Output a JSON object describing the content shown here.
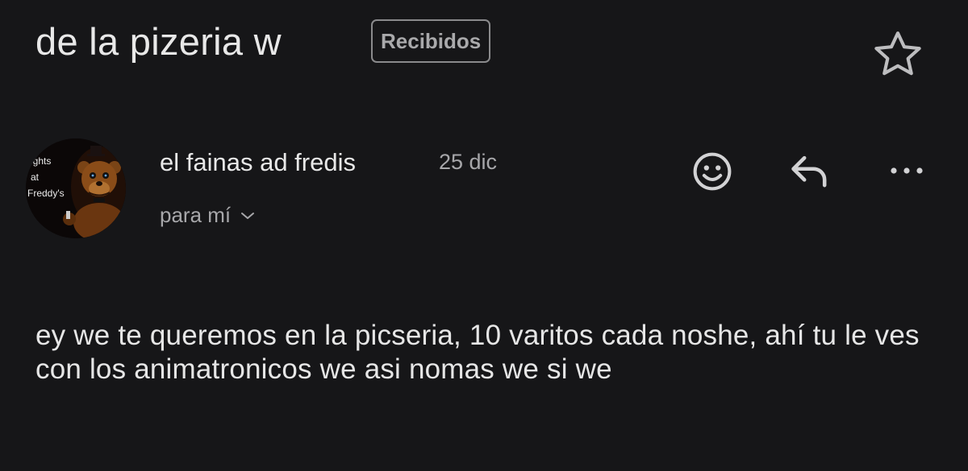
{
  "header": {
    "subject": "de la pizeria w",
    "label": "Recibidos",
    "star_icon": "star-outline-icon"
  },
  "message": {
    "avatar_text": [
      "ights",
      "at",
      "Freddy's"
    ],
    "sender": "el fainas ad fredis",
    "date": "25 dic",
    "recipient": "para mí",
    "actions": {
      "emoji_icon": "emoji-reaction-icon",
      "reply_icon": "reply-icon",
      "more_icon": "more-horizontal-icon"
    },
    "body": "ey we te queremos en la picseria, 10 varitos cada noshe, ahí tu le ves con los animatronicos we asi nomas we si we"
  },
  "colors": {
    "background": "#161618",
    "text_primary": "#e8e8e8",
    "text_secondary": "#a7a7aa",
    "chip_border": "#8a8a8c"
  }
}
